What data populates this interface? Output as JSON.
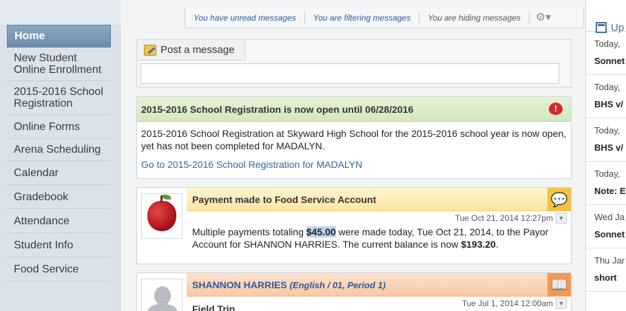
{
  "sidebar": {
    "items": [
      {
        "label": "Home"
      },
      {
        "label": "New Student Online Enrollment"
      },
      {
        "label": "2015-2016 School Registration"
      },
      {
        "label": "Online Forms"
      },
      {
        "label": "Arena Scheduling"
      },
      {
        "label": "Calendar"
      },
      {
        "label": "Gradebook"
      },
      {
        "label": "Attendance"
      },
      {
        "label": "Student Info"
      },
      {
        "label": "Food Service"
      }
    ]
  },
  "filterbar": {
    "unread": "You have unread messages",
    "filtering": "You are filtering messages",
    "hiding": "You are hiding messages",
    "gear_icon": "gear-icon"
  },
  "post": {
    "tab_label": "Post a message",
    "input_placeholder": ""
  },
  "registration": {
    "title": "2015-2016 School Registration is now open until 06/28/2016",
    "body": "2015-2016 School Registration at Skyward High School for the 2015-2016 school year is now open, yet has not been completed for MADALYN.",
    "link": "Go to 2015-2016 School Registration for MADALYN",
    "alert_icon": "!"
  },
  "payment": {
    "title": "Payment made to Food Service Account",
    "date": "Tue Oct 21, 2014 12:27pm",
    "text_before": "Multiple payments totaling ",
    "amount": "$45.00",
    "text_middle": " were made today, Tue Oct 21, 2014, to the Payor Account for SHANNON HARRIES. The current balance is now ",
    "balance": "$193.20",
    "text_end": "."
  },
  "teacher": {
    "name": "SHANNON HARRIES",
    "class": "(English / 01, Period 1)",
    "date": "Tue Jul 1, 2014 12:00am",
    "subject": "Field Trip"
  },
  "upcoming": {
    "title": "Up",
    "rows": [
      {
        "date": "Today,",
        "title": "Sonnet"
      },
      {
        "date": "Today,",
        "title": "BHS v/"
      },
      {
        "date": "Today,",
        "title": "BHS v/"
      },
      {
        "date": "Today,",
        "title": "Note: E"
      },
      {
        "date": "Wed Ja",
        "title": "Sonnet"
      },
      {
        "date": "Thu Jar",
        "title": "short"
      }
    ]
  }
}
